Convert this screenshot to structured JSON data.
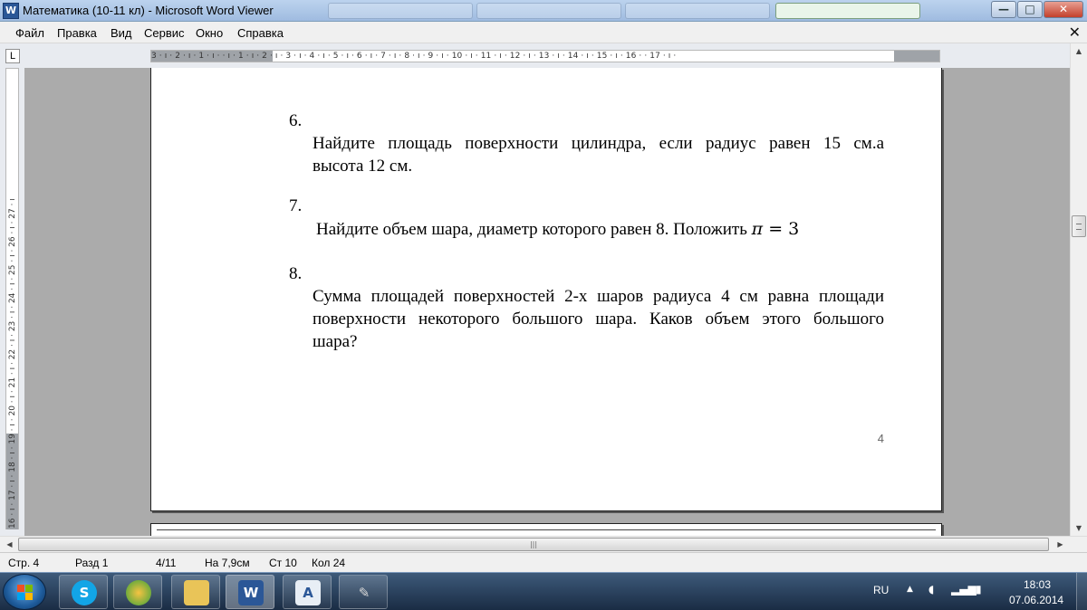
{
  "window": {
    "title": "Математика (10-11 кл) - Microsoft Word Viewer",
    "app_icon": "word-viewer-icon",
    "controls": {
      "minimize": "—",
      "maximize": "□",
      "close": "✕"
    }
  },
  "menu": {
    "items": [
      "Файл",
      "Правка",
      "Вид",
      "Сервис",
      "Окно",
      "Справка"
    ],
    "close_glyph": "✕"
  },
  "ruler": {
    "corner": "L",
    "horizontal_ticks": "3 · ı · 2 · ı · 1 · ı ·   · ı · 1 · ı · 2 · ı · 3 · ı · 4 · ı · 5 · ı · 6 · ı · 7 · ı · 8 · ı · 9 · ı · 10 · ı · 11 · ı · 12 · ı · 13 · ı · 14 · ı · 15 · ı · 16 ·   · 17 · ı ·",
    "vertical_ticks": "16 · ı · 17 · ı · 18 · ı · 19 · ı · 20 · ı · 21 · ı · 22 · ı · 23 · ı · 24 · ı · 25 · ı · 26 · ı · 27 · ı"
  },
  "document": {
    "questions": [
      {
        "number": "6.",
        "lines": [
          "Найдите площадь поверхности цилиндра, если радиус равен 15 см.а",
          "высота 12 см."
        ]
      },
      {
        "number": "7.",
        "text": "Найдите объем шара, диаметр которого равен 8. Положить ",
        "math_var": "π",
        "math_eq": " = 3"
      },
      {
        "number": "8.",
        "lines": [
          "Сумма площадей поверхностей 2-х шаров радиуса 4 см равна площади",
          "поверхности некоторого большого шара. Каков объем этого большого",
          "шара?"
        ]
      }
    ],
    "page_number": "4"
  },
  "status": {
    "page": "Стр. 4",
    "section": "Разд 1",
    "pages": "4/11",
    "at": "На 7,9см",
    "line": "Ст 10",
    "col": "Кол 24"
  },
  "taskbar": {
    "apps": [
      "skype-icon",
      "browser-icon",
      "folder-icon",
      "word-viewer-icon",
      "document-icon",
      "tools-icon"
    ],
    "language": "RU",
    "time": "18:03",
    "date": "07.06.2014"
  },
  "colors": {
    "titlebar": "#bcd3ee",
    "taskbar": "#1a2c44",
    "workspace": "#ababab"
  }
}
